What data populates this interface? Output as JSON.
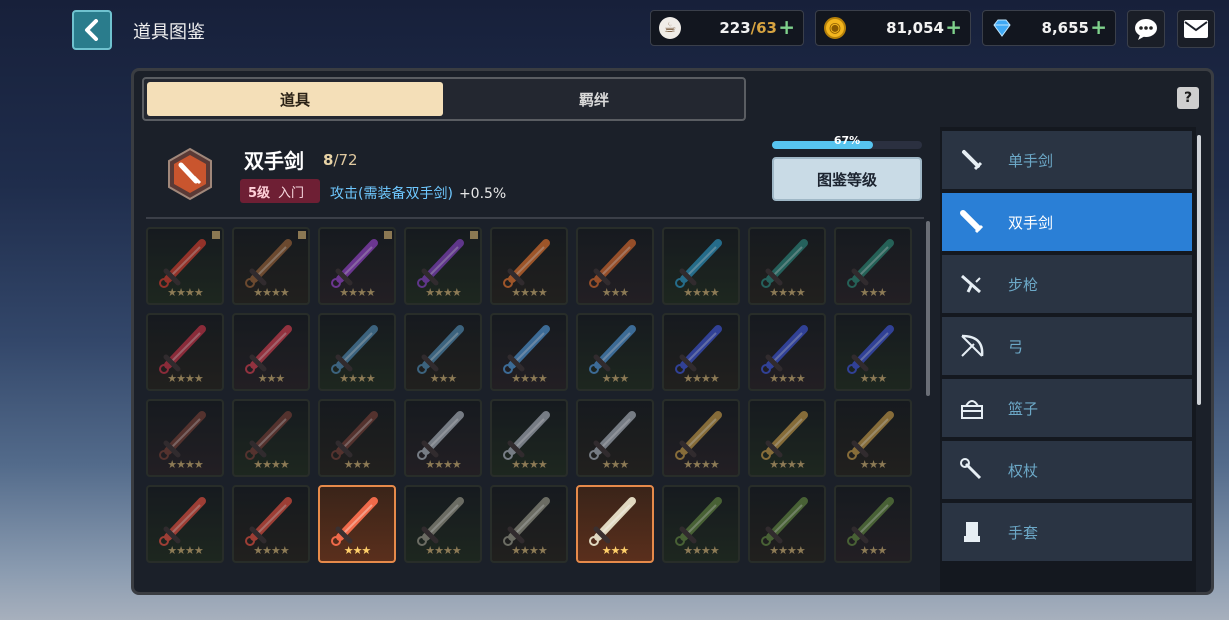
{
  "header": {
    "title": "道具图鉴",
    "back_icon": "chevron-left-icon"
  },
  "resources": [
    {
      "name": "stamina",
      "icon": "coffee-cup-icon",
      "value": "223",
      "max": "/63"
    },
    {
      "name": "gold",
      "icon": "gold-coin-icon",
      "value": "81,054"
    },
    {
      "name": "gems",
      "icon": "diamond-icon",
      "value": "8,655"
    }
  ],
  "tabs": [
    {
      "label": "道具"
    },
    {
      "label": "羁绊"
    }
  ],
  "help_label": "?",
  "category": {
    "name": "双手剑",
    "count_current": "8",
    "count_total": "/72",
    "level": "5级",
    "tier": "入门",
    "bonus_text": "攻击(需装备双手剑)",
    "bonus_value": "+0.5%",
    "progress_label": "67%",
    "progress_fraction": 0.67,
    "level_button": "图鉴等级"
  },
  "grid": {
    "rows": [
      [
        {
          "stars": "★★★★",
          "tag": true,
          "c": "#c23a2a"
        },
        {
          "stars": "★★★★",
          "tag": true,
          "c": "#8a5a32"
        },
        {
          "stars": "★★★★",
          "tag": true,
          "c": "#8a3fb8"
        },
        {
          "stars": "★★★★",
          "tag": true,
          "c": "#7a3fb0"
        },
        {
          "stars": "★★★★",
          "c": "#d06a2a"
        },
        {
          "stars": "★★★",
          "c": "#c5602a"
        },
        {
          "stars": "★★★★",
          "c": "#2a8ab0"
        },
        {
          "stars": "★★★★",
          "c": "#2a7a70"
        },
        {
          "stars": "★★★",
          "c": "#2a7a6a"
        }
      ],
      [
        {
          "stars": "★★★★",
          "c": "#b53040"
        },
        {
          "stars": "★★★",
          "c": "#c03a48"
        },
        {
          "stars": "★★★★",
          "c": "#4a7ea0"
        },
        {
          "stars": "★★★",
          "c": "#4a7ea0"
        },
        {
          "stars": "★★★★",
          "c": "#4a88c0"
        },
        {
          "stars": "★★★",
          "c": "#4a88c0"
        },
        {
          "stars": "★★★★",
          "c": "#3a4ec0"
        },
        {
          "stars": "★★★★",
          "c": "#3a4ec0"
        },
        {
          "stars": "★★★",
          "c": "#3a4ec0"
        }
      ],
      [
        {
          "stars": "★★★★",
          "c": "#6a3a30"
        },
        {
          "stars": "★★★★",
          "c": "#6a3a30"
        },
        {
          "stars": "★★★",
          "c": "#6a3a30"
        },
        {
          "stars": "★★★★",
          "c": "#9aa0a8"
        },
        {
          "stars": "★★★★",
          "c": "#9aa0a8"
        },
        {
          "stars": "★★★",
          "c": "#9aa0a8"
        },
        {
          "stars": "★★★★",
          "c": "#b08a40"
        },
        {
          "stars": "★★★★",
          "c": "#b08a40"
        },
        {
          "stars": "★★★",
          "c": "#b08a40"
        }
      ],
      [
        {
          "stars": "★★★★",
          "c": "#d04a3a"
        },
        {
          "stars": "★★★★",
          "c": "#d04a3a"
        },
        {
          "stars": "★★★",
          "c": "#f06a4a",
          "sel": true
        },
        {
          "stars": "★★★★",
          "c": "#8a8a7a"
        },
        {
          "stars": "★★★★",
          "c": "#8a8a7a"
        },
        {
          "stars": "★★★",
          "c": "#e0d8c0",
          "sel": true
        },
        {
          "stars": "★★★★",
          "c": "#5a7a3a"
        },
        {
          "stars": "★★★★",
          "c": "#5a7a3a"
        },
        {
          "stars": "★★★",
          "c": "#5a7a3a"
        }
      ]
    ]
  },
  "sidebar": {
    "items": [
      {
        "label": "单手剑",
        "icon": "one-handed-sword-icon"
      },
      {
        "label": "双手剑",
        "icon": "two-handed-sword-icon",
        "active": true
      },
      {
        "label": "步枪",
        "icon": "rifle-icon"
      },
      {
        "label": "弓",
        "icon": "bow-icon"
      },
      {
        "label": "篮子",
        "icon": "basket-icon"
      },
      {
        "label": "权杖",
        "icon": "scepter-icon"
      },
      {
        "label": "手套",
        "icon": "gauntlet-icon"
      }
    ]
  }
}
